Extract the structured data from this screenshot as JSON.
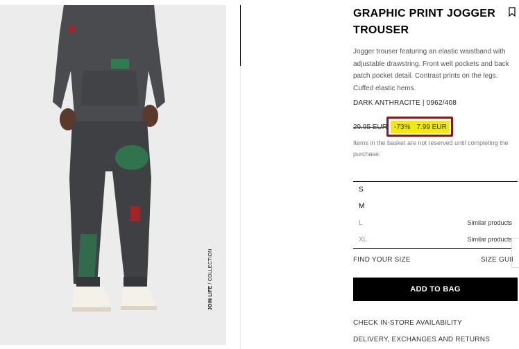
{
  "product": {
    "title": "GRAPHIC PRINT JOGGER TROUSER",
    "description": "Jogger trouser featuring an elastic waistband with adjustable drawstring. Front welt pockets and back patch pocket detail. Contrast prints on the legs. Cuffed elastic hems.",
    "color_ref": "DARK ANTHRACITE | 0962/408",
    "old_price": "29.95 EUR",
    "discount": "-73%",
    "new_price": "7.99 EUR",
    "basket_note": "Items in the basket are not reserved until completing the purchase.",
    "image_tag_bold": "JOIN LIFE",
    "image_tag_rest": " / COLLECTION"
  },
  "sizes": [
    {
      "label": "S",
      "extra": "",
      "available": true
    },
    {
      "label": "M",
      "extra": "",
      "available": true
    },
    {
      "label": "L",
      "extra": "Similar products",
      "available": false
    },
    {
      "label": "XL",
      "extra": "Similar products",
      "available": false
    }
  ],
  "actions": {
    "find_size": "FIND YOUR SIZE",
    "size_guide": "SIZE GUIDE",
    "add_to_bag": "ADD TO BAG",
    "check_store": "CHECK IN-STORE AVAILABILITY",
    "delivery": "DELIVERY, EXCHANGES AND RETURNS"
  },
  "colors": {
    "highlight": "#f2ea00",
    "highlight_border": "#9b1010",
    "button": "#000000"
  },
  "icons": {
    "bookmark": "bookmark-icon"
  }
}
